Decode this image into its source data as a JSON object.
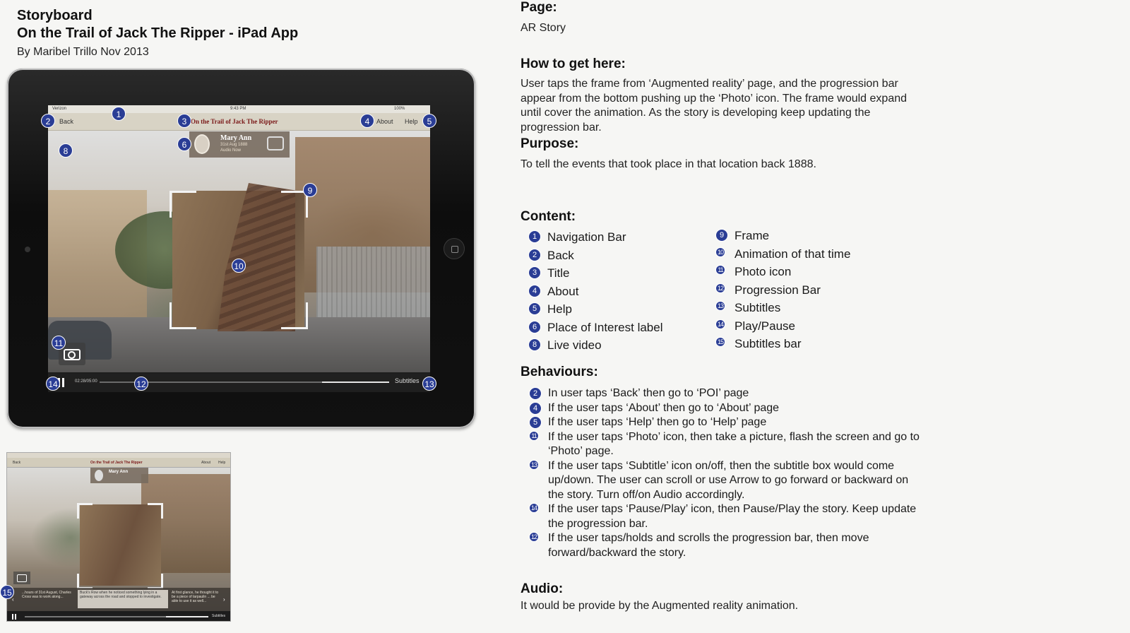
{
  "header": {
    "title": "Storyboard",
    "subtitle": "On the Trail of Jack The Ripper - iPad App",
    "byline": "By Maribel Trillo Nov 2013"
  },
  "mockup": {
    "status_carrier": "Verizon",
    "status_time": "9:43 PM",
    "status_battery": "100%",
    "nav_back": "Back",
    "nav_title": "On the Trail of Jack The Ripper",
    "nav_about": "About",
    "nav_help": "Help",
    "poi_name": "Mary Ann",
    "poi_date": "31st Aug 1888",
    "poi_audio": "Audio Now",
    "time": "02:28/05:00",
    "subtitles_btn": "Subtitles",
    "progress": 0.79
  },
  "mini_mockup": {
    "nav_back": "Back",
    "nav_title": "On the Trail of Jack The Ripper",
    "nav_about": "About",
    "nav_help": "Help",
    "poi_name": "Mary Ann",
    "subtitle_cells": [
      "...hours of 31st August, Charles Cross was to work along...",
      "Buck's Row when he noticed something lying in a gateway across the road and stopped to investigate.",
      "At first glance, he thought it to be a piece of tarpaulin ... be able to use it as well..."
    ],
    "subtitles_btn": "Subtitles"
  },
  "badges": [
    "1",
    "2",
    "3",
    "4",
    "5",
    "6",
    "8",
    "9",
    "10",
    "11",
    "12",
    "13",
    "14",
    "15"
  ],
  "page": {
    "label": "Page:",
    "value": "AR Story"
  },
  "how": {
    "label": "How to get here:",
    "text": "User taps the frame from ‘Augmented reality’ page, and the progression bar appear from the bottom pushing up the ‘Photo’ icon. The frame would expand until cover the animation. As the story is developing keep updating the progression bar."
  },
  "purpose": {
    "label": "Purpose:",
    "text": "To tell the events that took place in that location back 1888."
  },
  "content": {
    "label": "Content:",
    "left": [
      {
        "n": "1",
        "label": "Navigation Bar"
      },
      {
        "n": "2",
        "label": "Back"
      },
      {
        "n": "3",
        "label": "Title"
      },
      {
        "n": "4",
        "label": "About"
      },
      {
        "n": "5",
        "label": "Help"
      },
      {
        "n": "6",
        "label": "Place of Interest label"
      },
      {
        "n": "8",
        "label": "Live video"
      }
    ],
    "right": [
      {
        "n": "9",
        "label": "Frame"
      },
      {
        "n": "10",
        "label": "Animation of that time"
      },
      {
        "n": "11",
        "label": "Photo icon"
      },
      {
        "n": "12",
        "label": "Progression Bar"
      },
      {
        "n": "13",
        "label": "Subtitles"
      },
      {
        "n": "14",
        "label": "Play/Pause"
      },
      {
        "n": "15",
        "label": "Subtitles bar"
      }
    ]
  },
  "behaviours": {
    "label": "Behaviours:",
    "items": [
      {
        "n": "2",
        "text": "In user taps ‘Back’ then go to ‘POI’ page"
      },
      {
        "n": "4",
        "text": "If the user taps ‘About’ then go to ‘About’ page"
      },
      {
        "n": "5",
        "text": "If the user taps ‘Help’ then go to ‘Help’ page"
      },
      {
        "n": "11",
        "text": "If the user taps ‘Photo’ icon, then take a picture, flash the screen and go to ‘Photo’ page."
      },
      {
        "n": "13",
        "text": "If the user taps ‘Subtitle’ icon on/off, then the subtitle box would come up/down.  The user can scroll or use Arrow to go forward or backward on the story. Turn off/on Audio accordingly."
      },
      {
        "n": "14",
        "text": "If the user taps ‘Pause/Play’ icon, then Pause/Play the story. Keep update the progression bar."
      },
      {
        "n": "12",
        "text": "If the user taps/holds and scrolls the progression bar, then move forward/backward the story."
      }
    ]
  },
  "audio": {
    "label": "Audio:",
    "text": "It would be provide by the Augmented reality animation."
  }
}
